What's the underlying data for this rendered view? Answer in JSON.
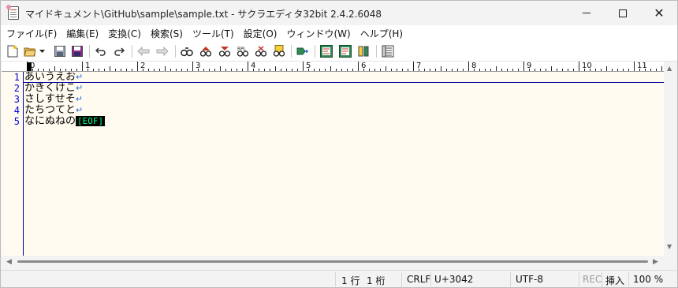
{
  "window": {
    "title": "マイドキュメント\\GitHub\\sample\\sample.txt - サクラエディタ32bit 2.4.2.6048"
  },
  "menu": [
    "ファイル(F)",
    "編集(E)",
    "変換(C)",
    "検索(S)",
    "ツール(T)",
    "設定(O)",
    "ウィンドウ(W)",
    "ヘルプ(H)"
  ],
  "toolbar_icons": [
    "new-file-icon",
    "open-file-icon",
    "open-dropdown-icon",
    "save-icon",
    "save-all-icon",
    "undo-icon",
    "redo-icon",
    "jump-back-icon",
    "jump-forward-icon",
    "find-icon",
    "find-next-icon",
    "find-prev-icon",
    "replace-icon",
    "clear-mark-icon",
    "grep-icon",
    "tag-jump-icon",
    "outline-icon",
    "compare-icon",
    "sort-icon",
    "settings-list-icon"
  ],
  "ruler": {
    "labels": [
      "0",
      "1",
      "2",
      "3",
      "4",
      "5",
      "6",
      "7",
      "8",
      "9",
      "10",
      "11"
    ]
  },
  "editor": {
    "lines": [
      {
        "number": "1",
        "text": "あいうえお",
        "end": "↵"
      },
      {
        "number": "2",
        "text": "かきくけこ",
        "end": "↵"
      },
      {
        "number": "3",
        "text": "さしすせそ",
        "end": "↵"
      },
      {
        "number": "4",
        "text": "たちつてと",
        "end": "↵"
      },
      {
        "number": "5",
        "text": "なにぬねの",
        "end": "[EOF]"
      }
    ],
    "colors": {
      "background": "#fffbf0",
      "line_number": "#0000e0",
      "eof_text": "#00ff88"
    }
  },
  "status": {
    "line": "1 行",
    "column": "1 桁",
    "newline": "CRLF",
    "codepoint": "U+3042",
    "encoding": "UTF-8",
    "rec": "REC",
    "mode": "挿入",
    "zoom": "100 %"
  }
}
